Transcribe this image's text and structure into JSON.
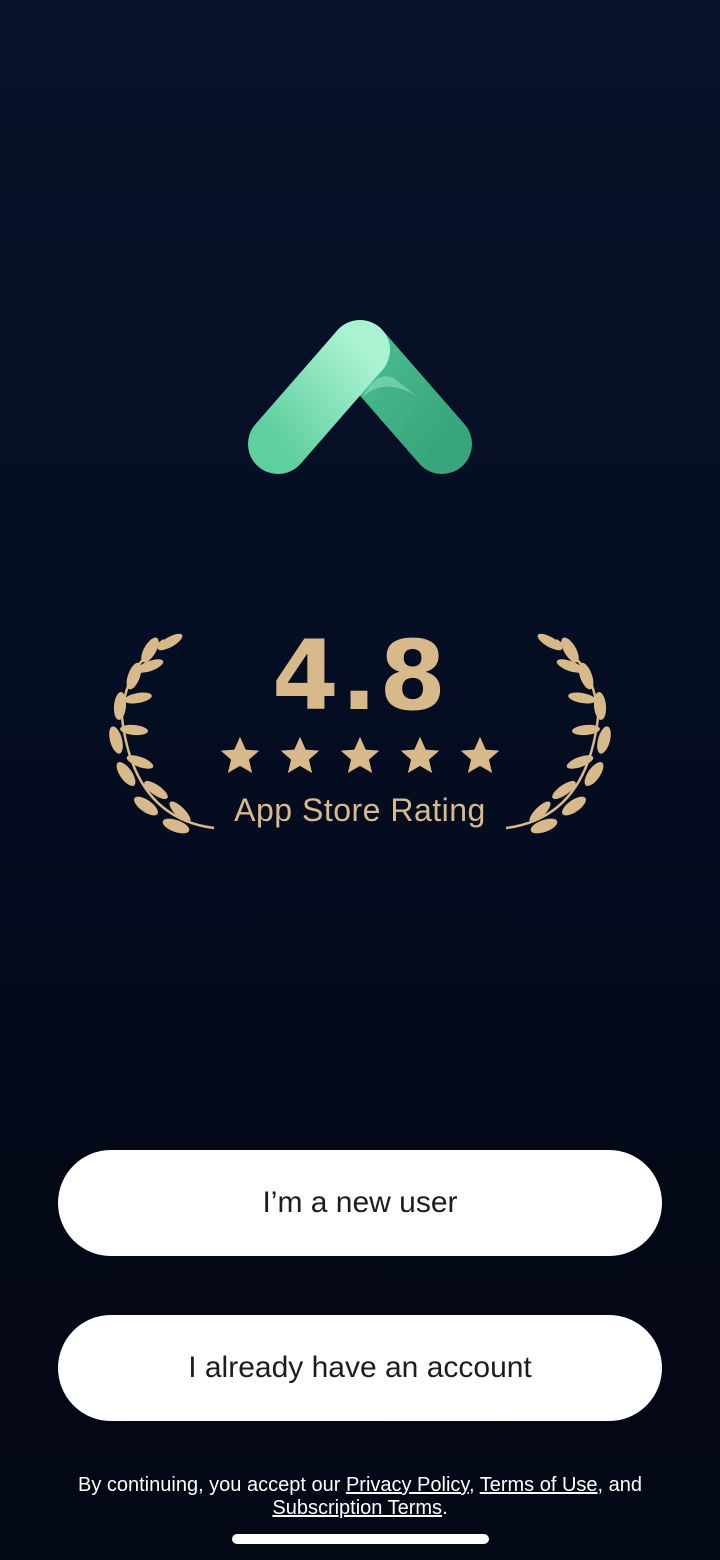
{
  "logo": {
    "icon": "chevron-up-logo-icon",
    "colors": [
      "#a6f0cf",
      "#5cc99a",
      "#3aa980"
    ]
  },
  "rating": {
    "value": "4.8",
    "stars": 5,
    "label": "App Store Rating",
    "color": "#d8b98a"
  },
  "buttons": {
    "new_user": "I’m a new user",
    "existing_user": "I already have an account"
  },
  "legal": {
    "prefix": "By continuing, you accept our ",
    "privacy": "Privacy Policy",
    "sep1": ", ",
    "terms": "Terms of Use",
    "sep2": ", and ",
    "subscription": "Subscription Terms",
    "suffix": "."
  }
}
